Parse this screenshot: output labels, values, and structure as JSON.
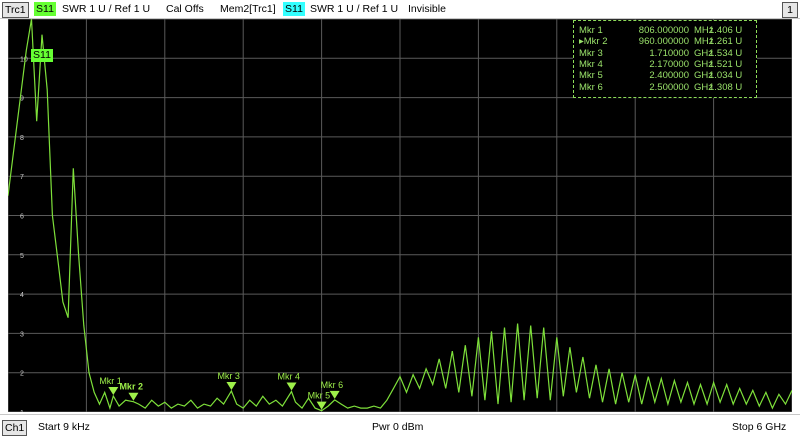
{
  "header": {
    "trace_name": "Trc1",
    "trace_param": "S11",
    "trace_format": "SWR  1 U /  Ref 1 U",
    "cal_state": "Cal Offs",
    "mem_name": "Mem2[Trc1]",
    "mem_param": "S11",
    "mem_format": "SWR  1 U /  Ref 1 U",
    "mem_state": "Invisible",
    "window_number": "1"
  },
  "trace_label": "S11",
  "markers": [
    {
      "name": "Mkr 1",
      "freq": "806.000000",
      "unit": "MHz",
      "value": "1.406 U",
      "active": false,
      "plot_label": "Mkr 1"
    },
    {
      "name": "Mkr 2",
      "freq": "960.000000",
      "unit": "MHz",
      "value": "1.261 U",
      "active": true,
      "plot_label": "Mkr 2"
    },
    {
      "name": "Mkr 3",
      "freq": "1.710000",
      "unit": "GHz",
      "value": "1.534 U",
      "active": false,
      "plot_label": "Mkr 3"
    },
    {
      "name": "Mkr 4",
      "freq": "2.170000",
      "unit": "GHz",
      "value": "1.521 U",
      "active": false,
      "plot_label": "Mkr 4"
    },
    {
      "name": "Mkr 5",
      "freq": "2.400000",
      "unit": "GHz",
      "value": "1.034 U",
      "active": false,
      "plot_label": "Mkr 5"
    },
    {
      "name": "Mkr 6",
      "freq": "2.500000",
      "unit": "GHz",
      "value": "1.308 U",
      "active": false,
      "plot_label": "Mkr 6"
    }
  ],
  "footer": {
    "channel": "Ch1",
    "start": "Start  9 kHz",
    "power": "Pwr  0 dBm",
    "stop": "Stop  6 GHz"
  },
  "colors": {
    "trace": "#7ee03a",
    "grid": "#5a5a5a",
    "marker": "#9ef04a",
    "badge_green": "#66ff33",
    "badge_cyan": "#33ffff"
  },
  "chart_data": {
    "type": "line",
    "xlim": [
      9e-06,
      6
    ],
    "ylim": [
      1,
      11
    ],
    "y_tick_labels": [
      "10",
      "9",
      "8",
      "7",
      "6",
      "5",
      "4",
      "3",
      "2",
      "1"
    ],
    "grid": true,
    "series": [
      {
        "x": [
          9e-06,
          0.14,
          0.18,
          0.22,
          0.26,
          0.3,
          0.34,
          0.38,
          0.42,
          0.46,
          0.5,
          0.54,
          0.58,
          0.62,
          0.66,
          0.7,
          0.74,
          0.78,
          0.806,
          0.85,
          0.9,
          0.96,
          1.0,
          1.05,
          1.1,
          1.15,
          1.2,
          1.25,
          1.3,
          1.35,
          1.4,
          1.45,
          1.5,
          1.55,
          1.6,
          1.65,
          1.71,
          1.75,
          1.8,
          1.85,
          1.9,
          1.95,
          2.0,
          2.05,
          2.1,
          2.17,
          2.2,
          2.25,
          2.3,
          2.35,
          2.4,
          2.45,
          2.5,
          2.55,
          2.6,
          2.65,
          2.7,
          2.75,
          2.8,
          2.85,
          2.9,
          2.95,
          3.0,
          3.05,
          3.1,
          3.15,
          3.2,
          3.25,
          3.3,
          3.35,
          3.4,
          3.45,
          3.5,
          3.55,
          3.6,
          3.65,
          3.7,
          3.75,
          3.8,
          3.85,
          3.9,
          3.95,
          4.0,
          4.05,
          4.1,
          4.15,
          4.2,
          4.25,
          4.3,
          4.35,
          4.4,
          4.45,
          4.5,
          4.55,
          4.6,
          4.65,
          4.7,
          4.75,
          4.8,
          4.85,
          4.9,
          4.95,
          5.0,
          5.05,
          5.1,
          5.15,
          5.2,
          5.25,
          5.3,
          5.35,
          5.4,
          5.45,
          5.5,
          5.55,
          5.6,
          5.65,
          5.7,
          5.75,
          5.8,
          5.85,
          5.9,
          5.95,
          6.0
        ],
        "values": [
          6.5,
          10.2,
          11.0,
          8.4,
          10.6,
          9.2,
          6.0,
          4.9,
          3.8,
          3.4,
          7.2,
          5.0,
          3.2,
          2.0,
          1.5,
          1.2,
          1.5,
          1.1,
          1.406,
          1.15,
          1.3,
          1.261,
          1.2,
          1.1,
          1.3,
          1.15,
          1.25,
          1.1,
          1.2,
          1.15,
          1.3,
          1.1,
          1.2,
          1.15,
          1.35,
          1.2,
          1.534,
          1.2,
          1.1,
          1.3,
          1.15,
          1.4,
          1.2,
          1.3,
          1.15,
          1.521,
          1.25,
          1.1,
          1.35,
          1.1,
          1.034,
          1.15,
          1.308,
          1.2,
          1.1,
          1.15,
          1.1,
          1.1,
          1.15,
          1.1,
          1.3,
          1.6,
          1.9,
          1.5,
          1.95,
          1.6,
          2.1,
          1.7,
          2.35,
          1.6,
          2.55,
          1.5,
          2.7,
          1.4,
          2.9,
          1.3,
          3.05,
          1.2,
          3.15,
          1.25,
          3.25,
          1.3,
          3.2,
          1.35,
          3.15,
          1.3,
          2.9,
          1.4,
          2.65,
          1.5,
          2.4,
          1.35,
          2.2,
          1.25,
          2.1,
          1.2,
          2.0,
          1.25,
          1.95,
          1.2,
          1.9,
          1.25,
          1.85,
          1.2,
          1.8,
          1.25,
          1.75,
          1.2,
          1.7,
          1.2,
          1.75,
          1.25,
          1.7,
          1.2,
          1.6,
          1.2,
          1.55,
          1.15,
          1.5,
          1.1,
          1.45,
          1.2,
          1.55
        ]
      }
    ]
  }
}
